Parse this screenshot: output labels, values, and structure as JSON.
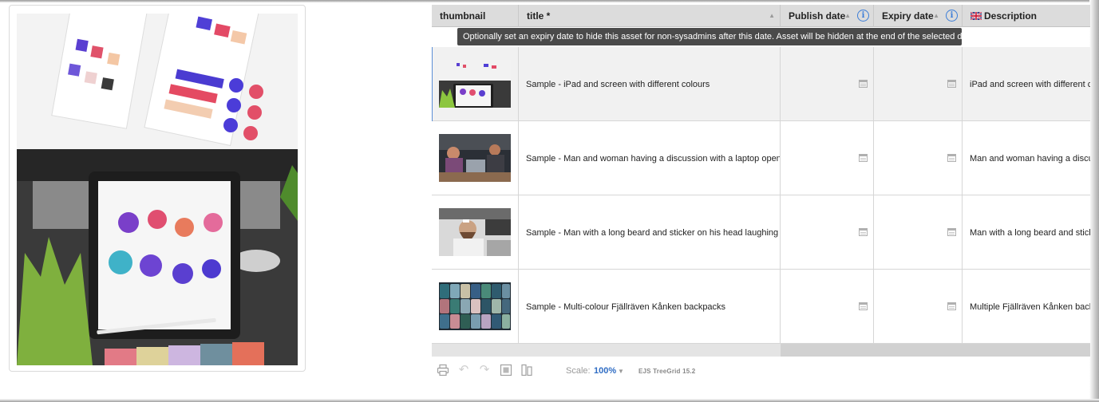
{
  "grid": {
    "columns": {
      "thumbnail": "thumbnail",
      "title": "title *",
      "publish_date": "Publish date",
      "expiry_date": "Expiry date",
      "description": "Description"
    },
    "tooltip": "Optionally set an expiry date to hide this asset for non-sysadmins after this date. Asset will be hidden at the end of the selected date",
    "rows": [
      {
        "title": "Sample - iPad and screen with different colours",
        "publish_date": "",
        "expiry_date": "",
        "description": "iPad and screen with different colours"
      },
      {
        "title": "Sample - Man and woman having a discussion with a laptop open",
        "publish_date": "",
        "expiry_date": "",
        "description": "Man and woman having a discussion with a laptop open"
      },
      {
        "title": "Sample - Man with a long beard and sticker on his head laughing",
        "publish_date": "",
        "expiry_date": "",
        "description": "Man with a long beard and sticker on his head laughing"
      },
      {
        "title": "Sample - Multi-colour Fjällräven Kånken backpacks",
        "publish_date": "",
        "expiry_date": "",
        "description": "Multiple Fjällräven Kånken backpacks"
      }
    ]
  },
  "toolbar": {
    "scale_label": "Scale:",
    "scale_value": "100%",
    "brand": "EJS TreeGrid 15.2"
  },
  "colors": {
    "accent": "#3b7dd8",
    "header_bg": "#dcdcdc",
    "tooltip_bg": "#4a4a4a",
    "selected_row_bg": "#f1f1f1"
  },
  "icons": [
    "sort-icon",
    "info-icon",
    "uk-flag-icon",
    "calendar-icon",
    "print-icon",
    "undo-icon",
    "redo-icon",
    "fit-icon",
    "columns-icon"
  ]
}
